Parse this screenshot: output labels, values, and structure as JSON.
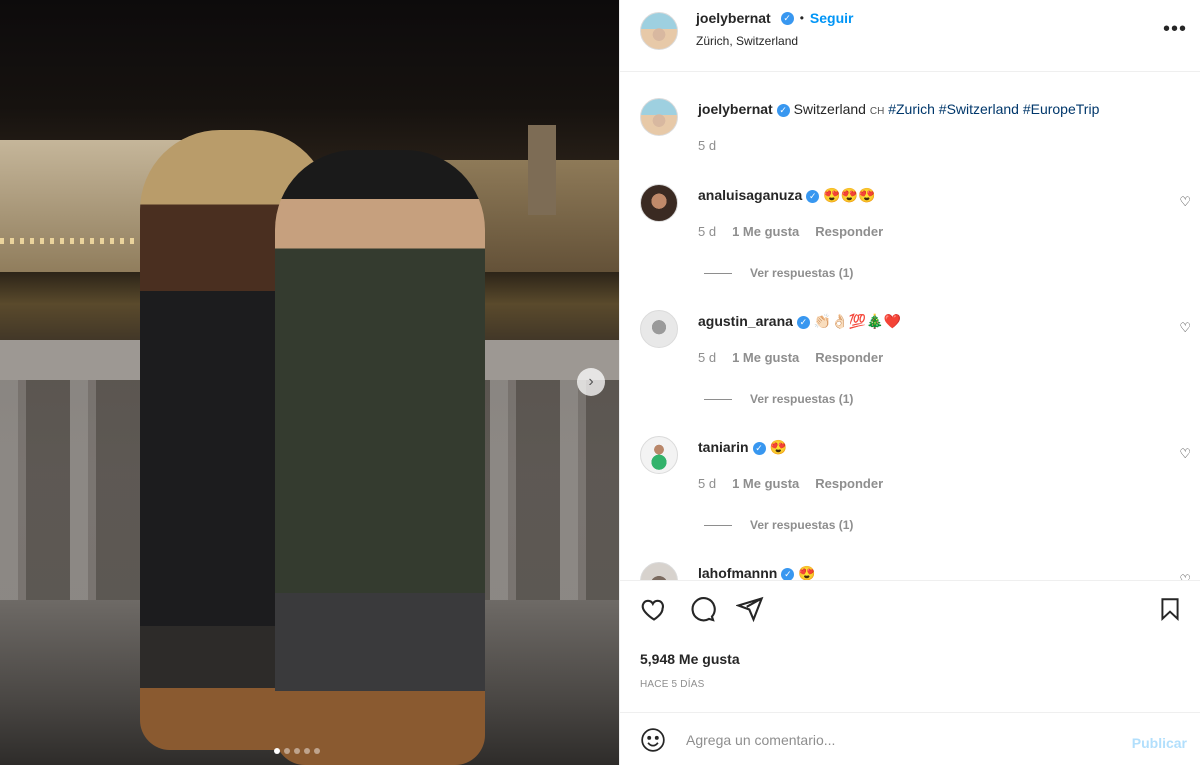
{
  "post": {
    "username": "joelybernat",
    "follow_label": "Seguir",
    "separator": "•",
    "location": "Zürich, Switzerland",
    "more_icon": "more-horizontal-icon"
  },
  "caption": {
    "username": "joelybernat",
    "text": "Switzerland",
    "flag": "CH",
    "hashtags": [
      "#Zurich",
      "#Switzerland",
      "#EuropeTrip"
    ],
    "time": "5 d"
  },
  "comments": [
    {
      "username": "analuisaganuza",
      "text": "😍😍😍",
      "time": "5 d",
      "likes": "1 Me gusta",
      "reply": "Responder",
      "view_replies": "Ver respuestas (1)"
    },
    {
      "username": "agustin_arana",
      "text": "👏🏻👌🏻💯🎄❤️",
      "time": "5 d",
      "likes": "1 Me gusta",
      "reply": "Responder",
      "view_replies": "Ver respuestas (1)"
    },
    {
      "username": "taniarin",
      "text": "😍",
      "time": "5 d",
      "likes": "1 Me gusta",
      "reply": "Responder",
      "view_replies": "Ver respuestas (1)"
    },
    {
      "username": "lahofmannn",
      "text": "😍"
    }
  ],
  "footer": {
    "likes": "5,948 Me gusta",
    "ago": "HACE 5 DÍAS",
    "comment_placeholder": "Agrega un comentario...",
    "publish_label": "Publicar"
  },
  "colors": {
    "accent": "#0095f6",
    "verified": "#3897f0",
    "muted": "#8e8e8e"
  },
  "carousel": {
    "dots": 5,
    "active_index": 0
  }
}
